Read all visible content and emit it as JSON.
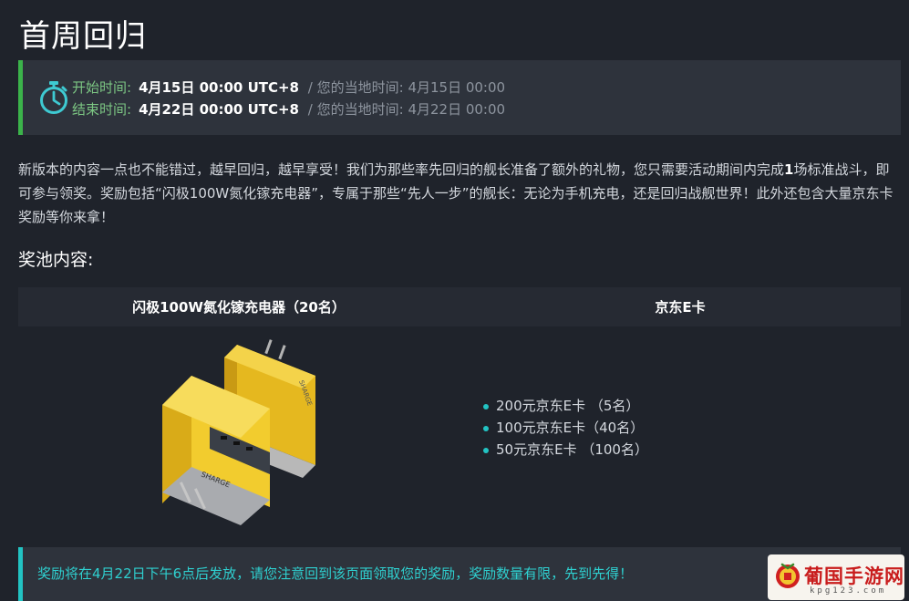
{
  "page": {
    "title": "首周回归"
  },
  "event_time": {
    "start": {
      "label": "开始时间:",
      "value": "4月15日 00:00 UTC+8",
      "separator": "/",
      "local": "您的当地时间: 4月15日 00:00"
    },
    "end": {
      "label": "结束时间:",
      "value": "4月22日 00:00 UTC+8",
      "separator": "/",
      "local": "您的当地时间: 4月22日 00:00"
    }
  },
  "description": {
    "part1": "新版本的内容一点也不能错过，越早回归，越早享受！我们为那些率先回归的舰长准备了额外的礼物，您只需要活动期间内完成",
    "bold": "1",
    "part2": "场标准战斗，即可参与领奖。奖励包括“闪极100W氮化镓充电器”，专属于那些“先人一步”的舰长：无论为手机充电，还是回归战舰世界！此外还包含大量京东卡奖励等你来拿！"
  },
  "prize_pool": {
    "title": "奖池内容:",
    "columns": [
      "闪极100W氮化镓充电器（20名）",
      "京东E卡"
    ],
    "charger_brand": "SHARGE",
    "card_items": [
      "200元京东E卡 （5名）",
      "100元京东E卡（40名）",
      "50元京东E卡 （100名）"
    ]
  },
  "notice": {
    "text": "奖励将在4月22日下午6点后发放，请您注意回到该页面领取您的奖励，奖励数量有限，先到先得！"
  },
  "watermark": {
    "title": "葡国手游网",
    "url": "kpg123.com"
  },
  "colors": {
    "background": "#1f232b",
    "panel": "#2e333c",
    "green_accent": "#3bb34a",
    "cyan_accent": "#22c3c3",
    "time_label": "#7cc683",
    "charger_yellow": "#f2cc2e"
  },
  "icons": {
    "clock": "stopwatch-icon",
    "logo": "coin-logo-icon"
  }
}
